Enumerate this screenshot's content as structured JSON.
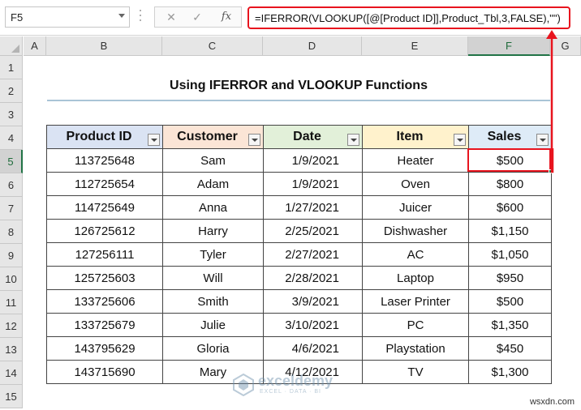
{
  "name_box": "F5",
  "formula_bar": {
    "cancel": "✕",
    "enter": "✓",
    "fx": "fx",
    "formula": "=IFERROR(VLOOKUP([@[Product ID]],Product_Tbl,3,FALSE),\"\")"
  },
  "columns": [
    "A",
    "B",
    "C",
    "D",
    "E",
    "F",
    "G"
  ],
  "rows": [
    "1",
    "2",
    "3",
    "4",
    "5",
    "6",
    "7",
    "8",
    "9",
    "10",
    "11",
    "12",
    "13",
    "14",
    "15"
  ],
  "selected_column": "F",
  "selected_row": "5",
  "sheet_title": "Using IFERROR and VLOOKUP Functions",
  "table": {
    "headers": [
      "Product ID",
      "Customer",
      "Date",
      "Item",
      "Sales"
    ],
    "header_colors": [
      "#dae3f3",
      "#fbe5d6",
      "#e2f0d9",
      "#fff2cc",
      "#deebf7"
    ],
    "rows": [
      [
        "113725648",
        "Sam",
        "1/9/2021",
        "Heater",
        "$500"
      ],
      [
        "112725654",
        "Adam",
        "1/9/2021",
        "Oven",
        "$800"
      ],
      [
        "114725649",
        "Anna",
        "1/27/2021",
        "Juicer",
        "$600"
      ],
      [
        "126725612",
        "Harry",
        "2/25/2021",
        "Dishwasher",
        "$1,150"
      ],
      [
        "127256111",
        "Tyler",
        "2/27/2021",
        "AC",
        "$1,050"
      ],
      [
        "125725603",
        "Will",
        "2/28/2021",
        "Laptop",
        "$950"
      ],
      [
        "133725606",
        "Smith",
        "3/9/2021",
        "Laser Printer",
        "$500"
      ],
      [
        "133725679",
        "Julie",
        "3/10/2021",
        "PC",
        "$1,350"
      ],
      [
        "143795629",
        "Gloria",
        "4/6/2021",
        "Playstation",
        "$450"
      ],
      [
        "143715690",
        "Mary",
        "4/12/2021",
        "TV",
        "$1,300"
      ]
    ]
  },
  "highlight_color": "#e8141e",
  "watermark": {
    "brand": "exceldemy",
    "tagline": "EXCEL · DATA · BI"
  },
  "site_credit": "wsxdn.com"
}
